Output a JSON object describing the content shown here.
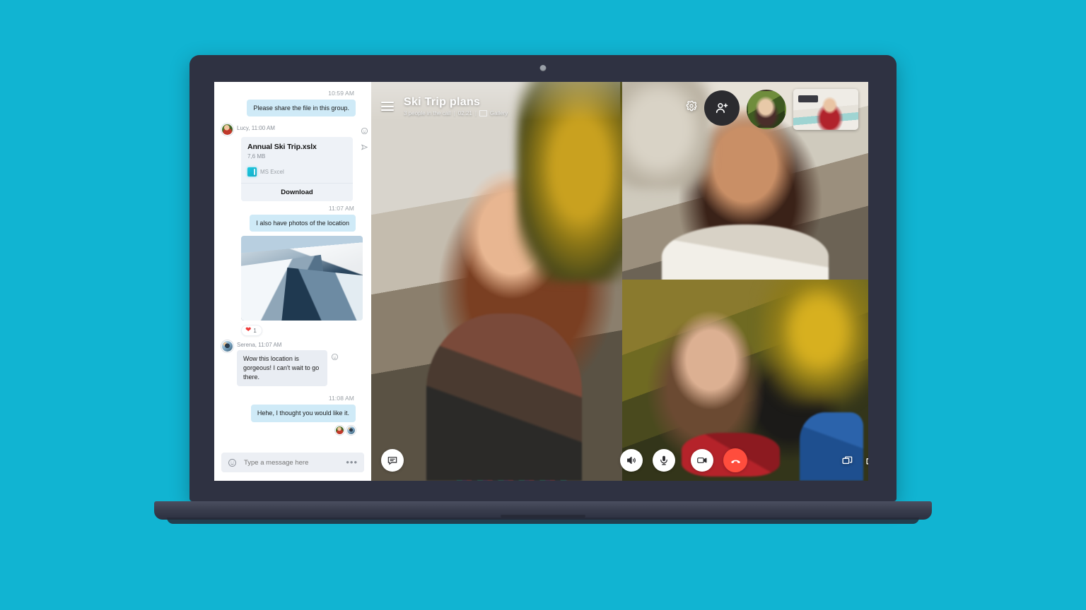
{
  "theme": {
    "background_color": "#11b4d2",
    "laptop_body_color": "#2f3242",
    "accent_blue": "#cfeaf7",
    "hangup_red": "#ff4d3d",
    "heart_red": "#ef3b39"
  },
  "chat": {
    "messages": [
      {
        "type": "timestamp",
        "align": "right",
        "text": "10:59 AM"
      },
      {
        "type": "outgoing",
        "text": "Please share the file in this group."
      },
      {
        "type": "sender",
        "text": "Lucy, 11:00 AM",
        "avatar": "lucy-avatar"
      },
      {
        "type": "file",
        "name": "Annual Ski Trip.xslx",
        "size": "7,6 MB",
        "app": "MS Excel",
        "download_label": "Download"
      },
      {
        "type": "timestamp",
        "align": "right",
        "text": "11:07 AM"
      },
      {
        "type": "outgoing",
        "text": "I also have photos of the location"
      },
      {
        "type": "photo",
        "alt": "snowy-mountain-ridge-photo"
      },
      {
        "type": "reaction",
        "emoji": "heart",
        "count": "1"
      },
      {
        "type": "sender",
        "text": "Serena, 11:07 AM",
        "avatar": "serena-avatar"
      },
      {
        "type": "incoming",
        "text": "Wow this location is gorgeous! I can't wait to go there."
      },
      {
        "type": "timestamp",
        "align": "right",
        "text": "11:08 AM"
      },
      {
        "type": "outgoing",
        "text": "Hehe, I thought you would like it."
      }
    ],
    "file_card": {
      "name": "Annual Ski Trip.xslx",
      "size": "7,6 MB",
      "app_label": "MS Excel",
      "download_label": "Download"
    },
    "reaction": {
      "emoji": "❤",
      "count": "1"
    },
    "composer": {
      "placeholder": "Type a message here",
      "value": "",
      "more_label": "•••"
    }
  },
  "call": {
    "title": "Ski Trip plans",
    "participants_text": "3 people in the call",
    "duration": "02:21",
    "separator": "|",
    "view_mode": "Gallery",
    "subtitle_full": "3 people in the call | 02:21  |  Gallery",
    "tiles": [
      {
        "name": "main-speaker-video",
        "label": ""
      },
      {
        "name": "participant-video-top-right",
        "label": ""
      },
      {
        "name": "participant-video-bottom-right",
        "label": ""
      }
    ],
    "thumbnails": [
      {
        "name": "self-view-round",
        "label": ""
      },
      {
        "name": "self-view-rect",
        "label": ""
      }
    ],
    "header_buttons": [
      {
        "name": "menu-button",
        "icon": "hamburger-icon"
      },
      {
        "name": "settings-button",
        "icon": "gear-icon"
      },
      {
        "name": "add-person-button",
        "icon": "add-person-icon"
      }
    ],
    "controls": [
      {
        "name": "chat-toggle-button",
        "icon": "chat-bubble-icon"
      },
      {
        "name": "speaker-button",
        "icon": "speaker-icon"
      },
      {
        "name": "microphone-button",
        "icon": "microphone-icon"
      },
      {
        "name": "camera-button",
        "icon": "video-camera-icon"
      },
      {
        "name": "hangup-button",
        "icon": "phone-hangup-icon"
      },
      {
        "name": "share-screen-button",
        "icon": "share-screen-icon"
      },
      {
        "name": "snapshot-button",
        "icon": "camera-snapshot-icon"
      },
      {
        "name": "reaction-heart-button",
        "icon": "heart-icon"
      },
      {
        "name": "more-button",
        "icon": "plus-icon"
      }
    ]
  }
}
